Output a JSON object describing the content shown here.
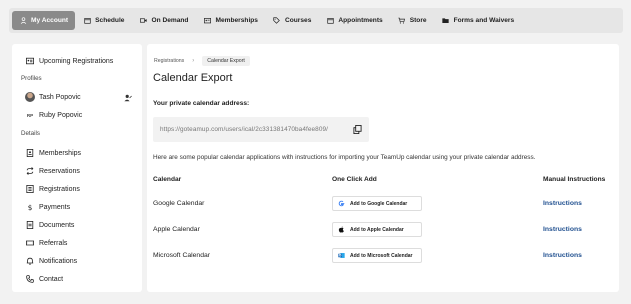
{
  "nav": {
    "items": [
      {
        "label": "My Account",
        "icon": "user-icon",
        "active": true
      },
      {
        "label": "Schedule",
        "icon": "calendar-icon"
      },
      {
        "label": "On Demand",
        "icon": "video-icon"
      },
      {
        "label": "Memberships",
        "icon": "id-card-icon"
      },
      {
        "label": "Courses",
        "icon": "tag-icon"
      },
      {
        "label": "Appointments",
        "icon": "calendar-icon"
      },
      {
        "label": "Store",
        "icon": "cart-icon"
      },
      {
        "label": "Forms and Waivers",
        "icon": "folder-icon"
      }
    ]
  },
  "sidebar": {
    "upcoming": "Upcoming Registrations",
    "profiles_heading": "Profiles",
    "profiles": [
      {
        "name": "Tash Popovic",
        "avatar": "photo"
      },
      {
        "name": "Ruby Popovic",
        "initials": "RP"
      }
    ],
    "details_heading": "Details",
    "details": [
      {
        "label": "Memberships",
        "icon": "id-card-icon"
      },
      {
        "label": "Reservations",
        "icon": "repeat-icon"
      },
      {
        "label": "Registrations",
        "icon": "list-icon"
      },
      {
        "label": "Payments",
        "icon": "dollar-icon"
      },
      {
        "label": "Documents",
        "icon": "document-icon"
      },
      {
        "label": "Referrals",
        "icon": "ticket-icon"
      },
      {
        "label": "Notifications",
        "icon": "bell-icon"
      },
      {
        "label": "Contact",
        "icon": "phone-icon"
      }
    ]
  },
  "main": {
    "breadcrumb": {
      "parent": "Registrations",
      "current": "Calendar Export"
    },
    "title": "Calendar Export",
    "address_label": "Your private calendar address:",
    "address_url": "https://goteamup.com/users/ical/2c331381470ba4fee809/",
    "intro": "Here are some popular calendar applications with instructions for importing your TeamUp calendar using your private calendar address.",
    "columns": {
      "calendar": "Calendar",
      "one_click": "One Click Add",
      "manual": "Manual Instructions"
    },
    "rows": [
      {
        "name": "Google Calendar",
        "button": "Add to Google Calendar",
        "link": "Instructions"
      },
      {
        "name": "Apple Calendar",
        "button": "Add to Apple Calendar",
        "link": "Instructions"
      },
      {
        "name": "Microsoft Calendar",
        "button": "Add to Microsoft Calendar",
        "link": "Instructions"
      }
    ]
  },
  "colors": {
    "active_nav": "#8a8a8a",
    "link": "#1f4f8f",
    "page_bg": "#f2f2f2"
  }
}
